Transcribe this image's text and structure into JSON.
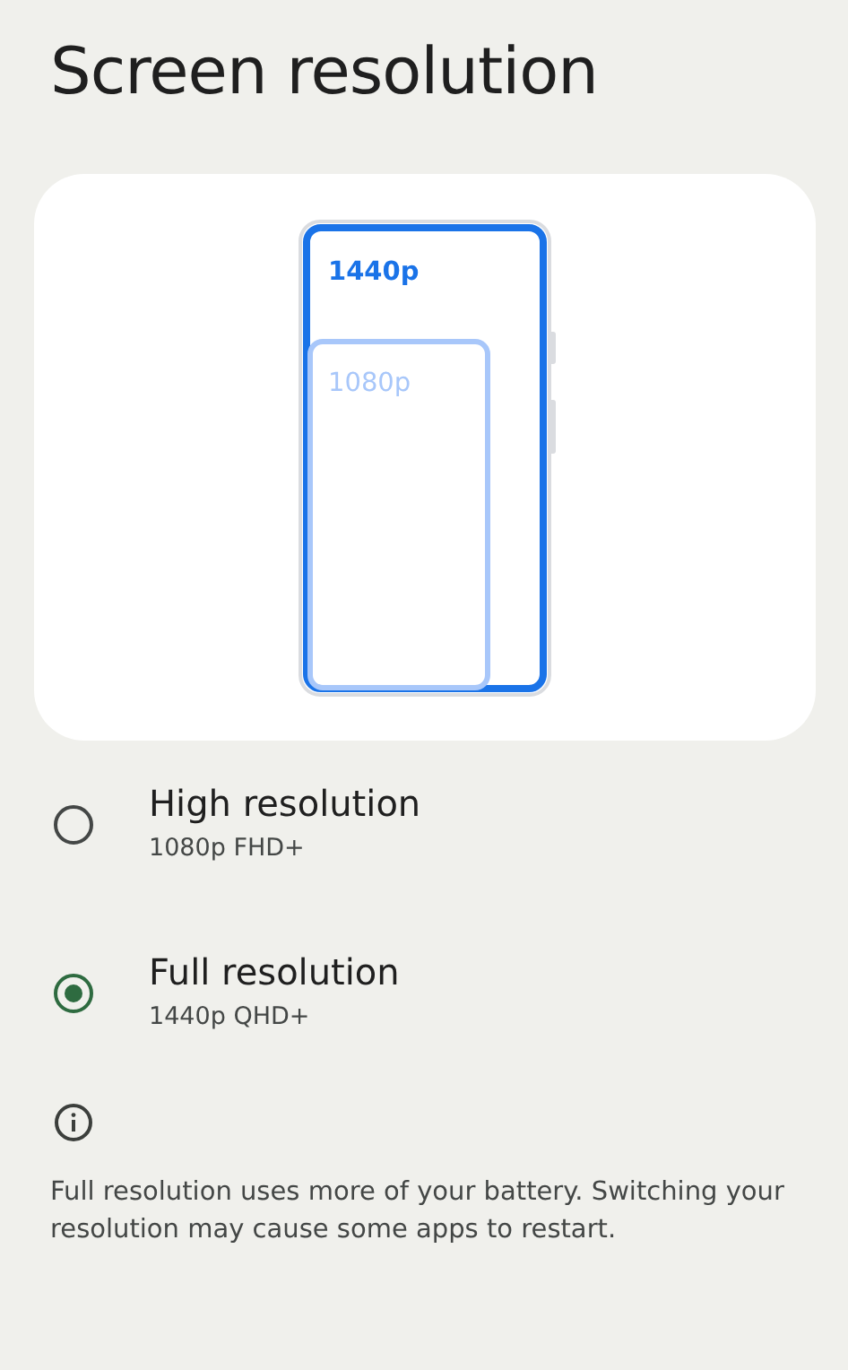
{
  "title": "Screen resolution",
  "preview": {
    "labels": [
      {
        "kind": "large",
        "text": "1440p"
      },
      {
        "kind": "small",
        "text": "1080p"
      }
    ]
  },
  "options": [
    {
      "title": "High resolution",
      "summary": "1080p FHD+",
      "selected": false
    },
    {
      "title": "Full resolution",
      "summary": "1440p QHD+",
      "selected": true
    }
  ],
  "footer": "Full resolution uses more of your battery. Switching your resolution may cause some apps to restart."
}
